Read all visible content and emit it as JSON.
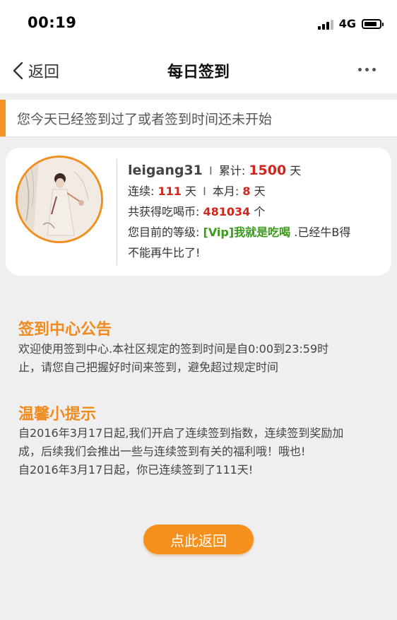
{
  "status_bar": {
    "time": "00:19",
    "network": "4G"
  },
  "nav": {
    "back_label": "返回",
    "title": "每日签到"
  },
  "notice": {
    "text": "您今天已经签到过了或者签到时间还未开始"
  },
  "user": {
    "username": "leigang31",
    "total_label": "累计:",
    "total_days": "1500",
    "day_unit": "天",
    "streak_label": "连续:",
    "streak_days": "111",
    "month_label": "本月:",
    "month_days": "8",
    "coins_label": "共获得吃喝币:",
    "coins": "481034",
    "coin_unit": "个",
    "level_label": "您目前的等级:",
    "level_name": "[Vip]我就是吃喝",
    "level_suffix": ".已经牛B得",
    "level_suffix2": "不能再牛比了!"
  },
  "announcement": {
    "title": "签到中心公告",
    "line1": "欢迎使用签到中心.本社区规定的签到时间是自0:00到23:59时",
    "line2": "止，请您自己把握好时间来签到，避免超过规定时间"
  },
  "tips": {
    "title": "温馨小提示",
    "line1": "自2016年3月17日起,我们开启了连续签到指数，连续签到奖励加",
    "line2": "成，后续我们会推出一些与连续签到有关的福利哦！哦也!",
    "line3": "自2016年3月17日起，你已连续签到了111天!"
  },
  "return_button": {
    "label": "点此返回"
  },
  "colors": {
    "accent": "#f08a1c",
    "highlight_red": "#d0261c",
    "level_green": "#3a9a1c"
  }
}
